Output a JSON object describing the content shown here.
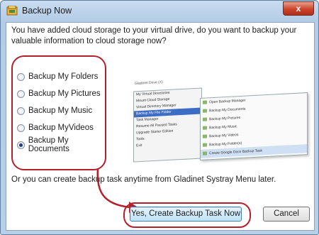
{
  "window": {
    "title": "Backup Now",
    "close_label": "x"
  },
  "dialog": {
    "intro_text": "You have added cloud storage to your virtual drive, do you want to backup your valuable information to cloud storage now?",
    "options": [
      {
        "label": "Backup My Folders",
        "checked": false
      },
      {
        "label": "Backup My Pictures",
        "checked": false
      },
      {
        "label": "Backup My Music",
        "checked": false
      },
      {
        "label": "Backup MyVideos",
        "checked": false
      },
      {
        "label": "Backup My Documents",
        "checked": true
      }
    ],
    "footer_text": "Or you can create backup task anytime from Gladinet Systray Menu later.",
    "primary_button": "Yes, Create Backup Task Now",
    "cancel_button": "Cancel"
  },
  "preview": {
    "header": "Gladinet Drive (X)",
    "menu_left": [
      "My Virtual Directories",
      "Mount Cloud Storage",
      "Virtual Directory Manager",
      "Backup My File Folder",
      "Task Manager",
      "Resume All Paused Tasks",
      "Upgrade Starter Edition",
      "Tools",
      "Exit"
    ],
    "menu_right": [
      "Open Backup Manager",
      "Backup My Documents",
      "Backup My Pictures",
      "Backup My Music",
      "Backup My Videos",
      "Backup My Folder(s)",
      "Create Google Docs Backup Task"
    ]
  },
  "colors": {
    "highlight": "#b3202b",
    "title_gradient_top": "#c9dcf0",
    "primary_button": "#bde2f7"
  }
}
